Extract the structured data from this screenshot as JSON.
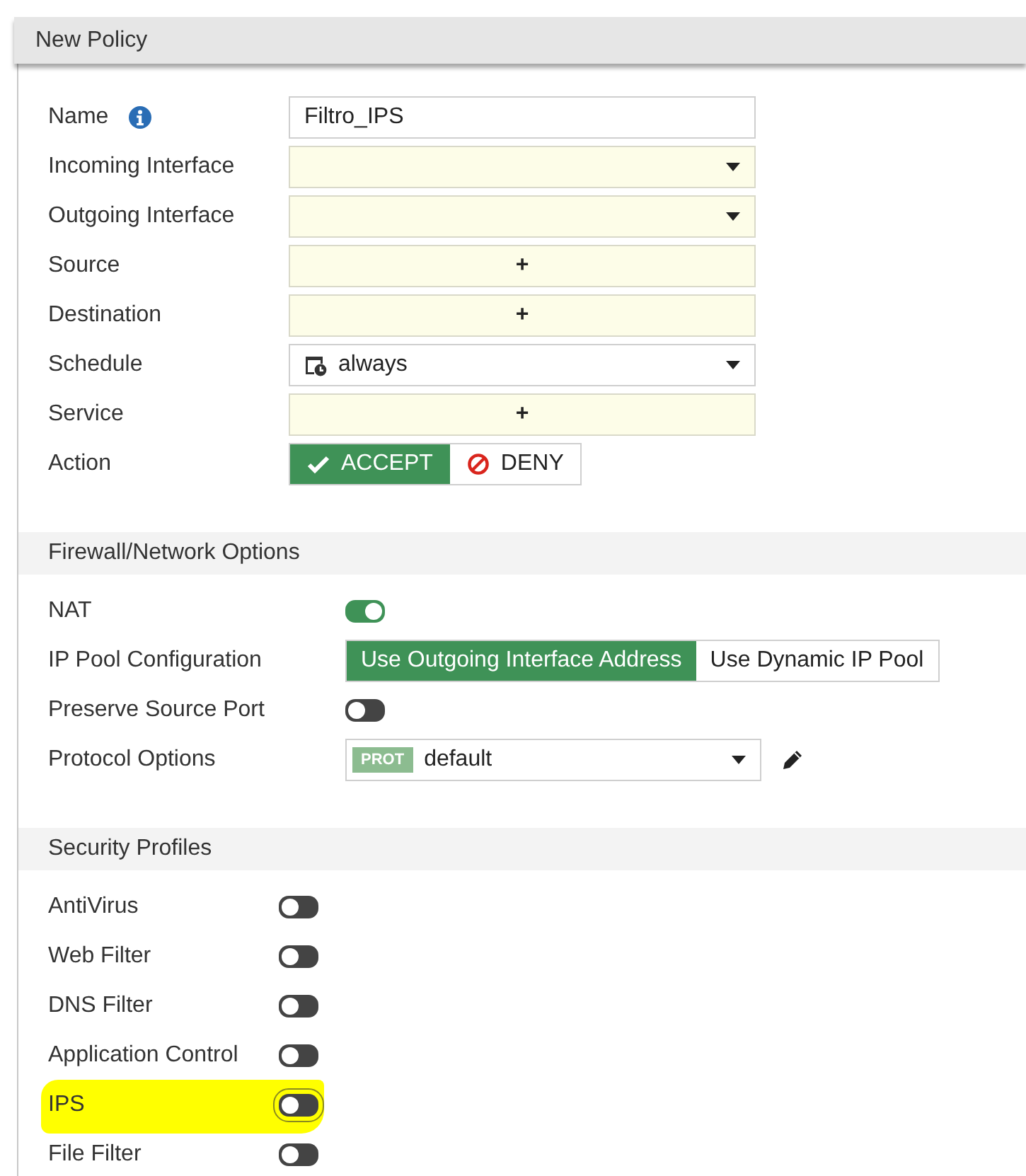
{
  "window": {
    "title": "New Policy"
  },
  "fields": [
    {
      "kind": "text",
      "label": "Name",
      "info": true,
      "value": "Filtro_IPS"
    },
    {
      "kind": "dropdown",
      "label": "Incoming Interface"
    },
    {
      "kind": "dropdown",
      "label": "Outgoing Interface"
    },
    {
      "kind": "add",
      "label": "Source",
      "value": "+"
    },
    {
      "kind": "add",
      "label": "Destination",
      "value": "+"
    },
    {
      "kind": "schedule",
      "label": "Schedule",
      "value": "always"
    },
    {
      "kind": "add",
      "label": "Service",
      "value": "+"
    }
  ],
  "action": {
    "label": "Action",
    "options": [
      {
        "label": "ACCEPT",
        "kind": "accept",
        "selected": true
      },
      {
        "label": "DENY",
        "kind": "deny",
        "selected": false
      }
    ]
  },
  "firewall_options": {
    "title": "Firewall/Network Options",
    "items": [
      {
        "kind": "toggle",
        "label": "NAT",
        "on": true
      },
      {
        "kind": "segmented",
        "label": "IP Pool Configuration",
        "options": [
          {
            "label": "Use Outgoing Interface Address",
            "selected": true
          },
          {
            "label": "Use Dynamic IP Pool",
            "selected": false
          }
        ]
      },
      {
        "kind": "toggle",
        "label": "Preserve Source Port",
        "on": false
      },
      {
        "kind": "select",
        "label": "Protocol Options",
        "badge": "PROT",
        "value": "default"
      }
    ]
  },
  "security_profiles": {
    "title": "Security Profiles",
    "items": [
      {
        "label": "AntiVirus",
        "on": false,
        "highlighted": false
      },
      {
        "label": "Web Filter",
        "on": false,
        "highlighted": false
      },
      {
        "label": "DNS Filter",
        "on": false,
        "highlighted": false
      },
      {
        "label": "Application Control",
        "on": false,
        "highlighted": false
      },
      {
        "label": "IPS",
        "on": false,
        "highlighted": true
      },
      {
        "label": "File Filter",
        "on": false,
        "highlighted": false
      }
    ]
  }
}
